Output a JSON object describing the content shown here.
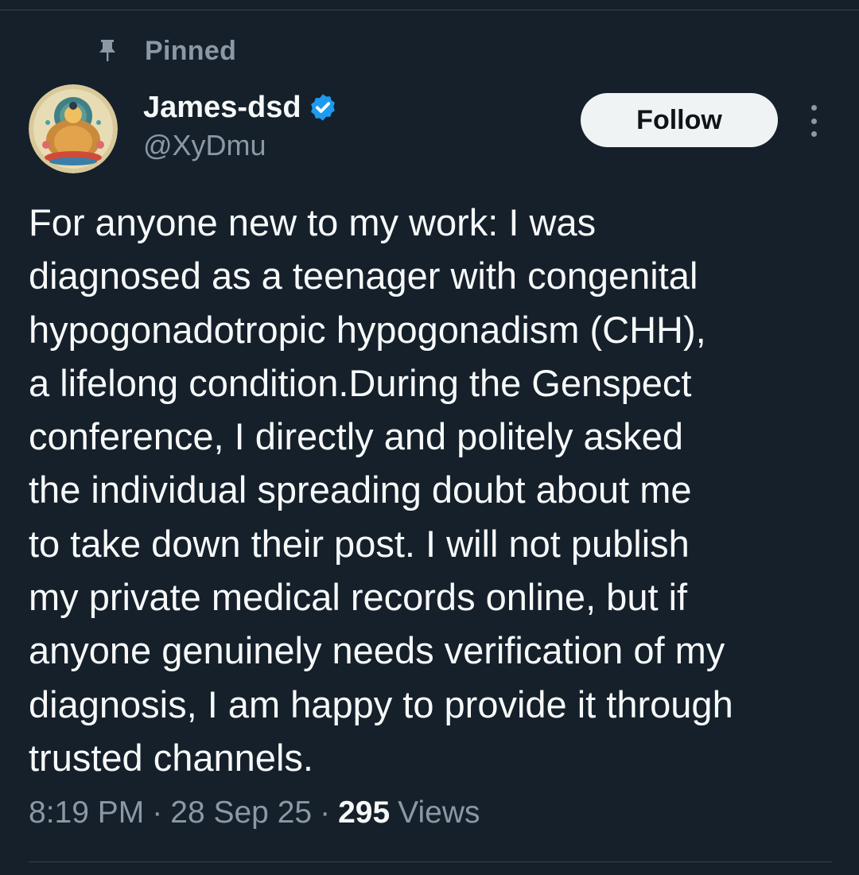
{
  "pinned_label": "Pinned",
  "author": {
    "display_name": "James-dsd",
    "handle": "@XyDmu",
    "verified": true,
    "avatar_icon": "buddha-avatar-icon"
  },
  "follow_label": "Follow",
  "tweet": {
    "text": "For anyone new to my work: I was\ndiagnosed as a teenager with congenital\nhypogonadotropic hypogonadism (CHH),\na lifelong condition.During the Genspect\nconference, I directly and politely asked\nthe individual spreading doubt about me\nto take down their post. I will not publish\nmy private medical records online, but if\nanyone genuinely needs verification of my\ndiagnosis, I am happy to provide it through\ntrusted channels.",
    "time": "8:19 PM",
    "separator": "·",
    "date": "28 Sep 25",
    "views_count": "295",
    "views_label": "Views"
  },
  "colors": {
    "background": "#15202b",
    "text_primary": "#f7f9f9",
    "text_secondary": "#8b98a5",
    "verified_blue": "#1d9bf0",
    "follow_bg": "#eff3f4"
  }
}
